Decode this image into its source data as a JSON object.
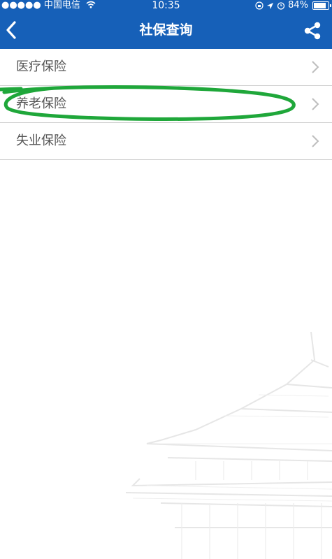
{
  "status_bar": {
    "carrier": "●●●●● 中国电信",
    "wifi_icon": "wifi-icon",
    "time": "10:35",
    "battery_percent": "84%",
    "battery_level": 0.84
  },
  "header": {
    "title": "社保查询",
    "back_icon": "chevron-left-icon",
    "share_icon": "share-icon"
  },
  "menu": {
    "items": [
      {
        "label": "医疗保险"
      },
      {
        "label": "养老保险"
      },
      {
        "label": "失业保险"
      }
    ]
  },
  "colors": {
    "header_bg": "#1660b8",
    "annotation": "#1fa73a",
    "divider": "#cfcfcf"
  }
}
